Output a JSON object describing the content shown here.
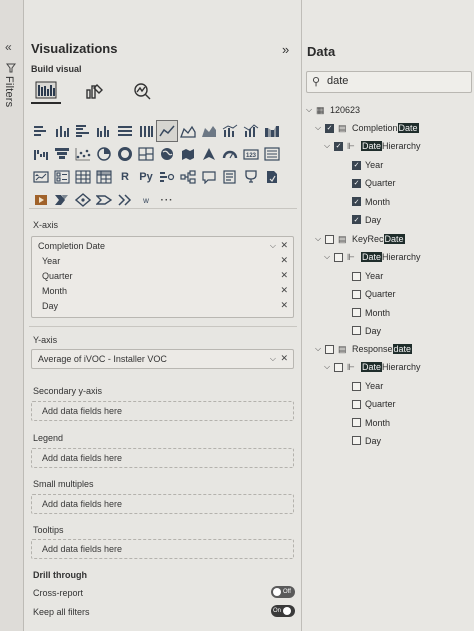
{
  "filters": {
    "label": "Filters"
  },
  "viz": {
    "title": "Visualizations",
    "build_visual": "Build visual",
    "gallery": [
      [
        "stacked-bar-chart-icon",
        "stacked-column-chart-icon",
        "clustered-bar-chart-icon",
        "clustered-column-chart-icon",
        "100-stacked-bar-chart-icon",
        "100-stacked-column-chart-icon",
        "line-chart-icon",
        "area-chart-icon",
        "stacked-area-chart-icon",
        "line-clustered-column-icon",
        "line-stacked-column-icon",
        "ribbon-chart-icon"
      ],
      [
        "waterfall-chart-icon",
        "funnel-chart-icon",
        "scatter-chart-icon",
        "pie-chart-icon",
        "donut-chart-icon",
        "treemap-icon",
        "map-icon",
        "filled-map-icon",
        "azure-map-icon",
        "gauge-icon",
        "card-icon",
        "multi-row-card-icon"
      ],
      [
        "kpi-icon",
        "slicer-icon",
        "table-visual-icon",
        "matrix-icon",
        "r-visual-icon",
        "python-visual-icon",
        "key-influencers-icon",
        "decomposition-tree-icon",
        "qa-icon",
        "smart-narrative-icon",
        "goals-icon",
        "paginated-report-icon"
      ],
      [
        "power-apps-icon",
        "power-automate-icon",
        "arcgis-map-icon",
        "shape-map-icon",
        "custom-visual-icon",
        "word-visual-icon",
        "more-visuals-icon"
      ]
    ],
    "gallery_text": {
      "r": "R",
      "py": "Py",
      "w": "w",
      "more": "···"
    },
    "x_axis": {
      "title": "X-axis",
      "field": "Completion Date",
      "items": [
        "Year",
        "Quarter",
        "Month",
        "Day"
      ]
    },
    "y_axis": {
      "title": "Y-axis",
      "field": "Average of iVOC - Installer VOC"
    },
    "wells": [
      {
        "title": "Secondary y-axis",
        "placeholder": "Add data fields here"
      },
      {
        "title": "Legend",
        "placeholder": "Add data fields here"
      },
      {
        "title": "Small multiples",
        "placeholder": "Add data fields here"
      },
      {
        "title": "Tooltips",
        "placeholder": "Add data fields here"
      }
    ],
    "drill": {
      "title": "Drill through",
      "cross_report": "Cross-report",
      "cross_report_state": "Off",
      "keep_all_filters": "Keep all filters",
      "keep_all_filters_state": "On"
    }
  },
  "data": {
    "title": "Data",
    "search_value": "date",
    "table": "120623",
    "fields": [
      {
        "pre": "Completion ",
        "hl": "Date",
        "post": "",
        "hier": {
          "pre": "",
          "hl": "Date",
          "post": " Hierarchy"
        },
        "children": [
          "Year",
          "Quarter",
          "Month",
          "Day"
        ]
      },
      {
        "pre": "KeyRec ",
        "hl": "Date",
        "post": "",
        "hier": {
          "pre": "",
          "hl": "Date",
          "post": " Hierarchy"
        },
        "children": [
          "Year",
          "Quarter",
          "Month",
          "Day"
        ]
      },
      {
        "pre": "Response",
        "hl": "date",
        "post": "",
        "hier": {
          "pre": "",
          "hl": "Date",
          "post": " Hierarchy"
        },
        "children": [
          "Year",
          "Quarter",
          "Month",
          "Day"
        ]
      }
    ]
  }
}
